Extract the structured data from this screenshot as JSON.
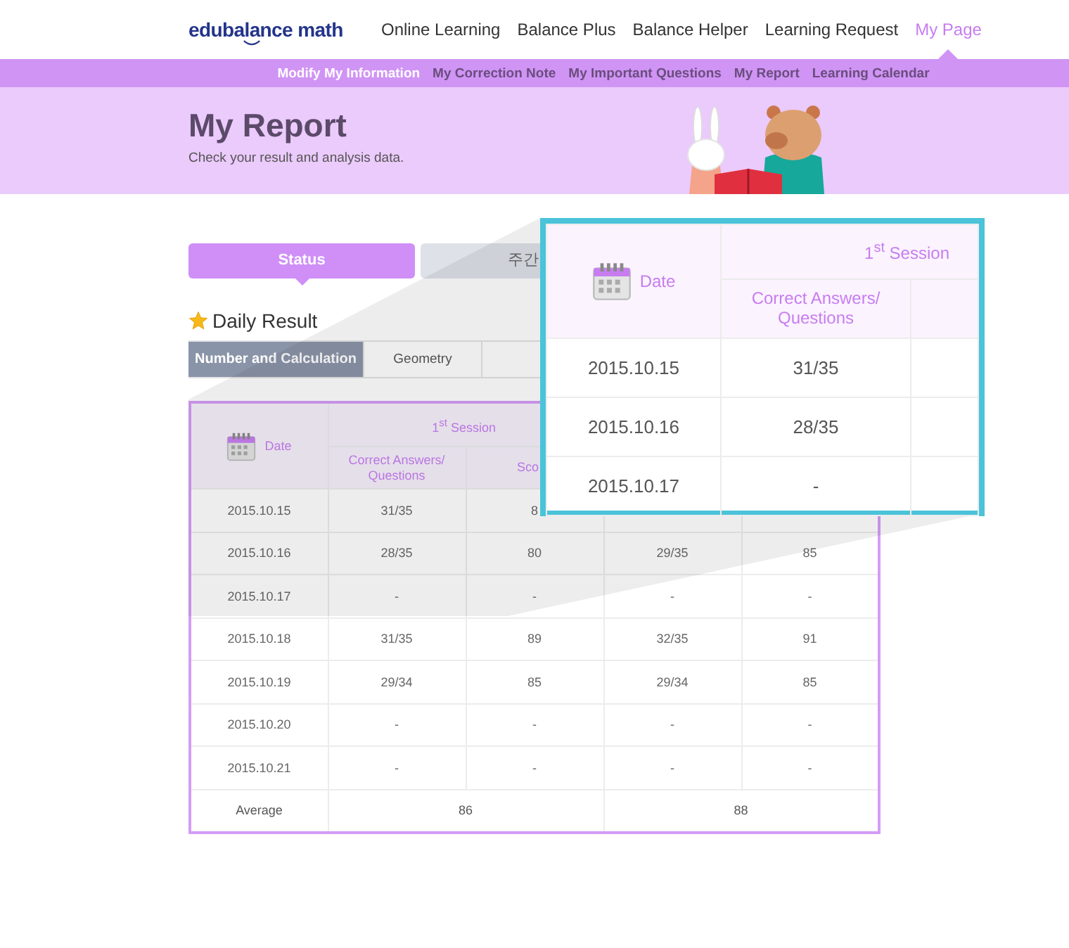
{
  "header": {
    "logo": "edubalance math",
    "nav": [
      {
        "label": "Online Learning",
        "selected": false
      },
      {
        "label": "Balance Plus",
        "selected": false
      },
      {
        "label": "Balance Helper",
        "selected": false
      },
      {
        "label": "Learning Request",
        "selected": false
      },
      {
        "label": "My Page",
        "selected": true
      }
    ]
  },
  "subnav": [
    {
      "label": "Modify My Information",
      "selected": true
    },
    {
      "label": "My Correction Note",
      "selected": false
    },
    {
      "label": "My Important Questions",
      "selected": false
    },
    {
      "label": "My Report",
      "selected": false
    },
    {
      "label": "Learning Calendar",
      "selected": false
    }
  ],
  "banner": {
    "title": "My Report",
    "subtitle": "Check your result and analysis data."
  },
  "view_tabs": [
    {
      "label": "Status",
      "selected": true
    },
    {
      "label": "주간",
      "selected": false
    }
  ],
  "section_title": "Daily Result",
  "subject_tabs": [
    {
      "label": "Number and Calculation",
      "selected": true
    },
    {
      "label": "Geometry",
      "selected": false
    }
  ],
  "table": {
    "date_header": "Date",
    "session_header": "1$^{st}$ Session",
    "subheaders": [
      "Correct Answers/ Questions",
      "Sco"
    ],
    "rows": [
      {
        "cells": [
          "2015.10.15",
          "31/35",
          "8"
        ]
      },
      {
        "cells": [
          "2015.10.16",
          "28/35",
          "80",
          "29/35",
          "85"
        ]
      },
      {
        "cells": [
          "2015.10.17",
          "-",
          "-",
          "-",
          "-"
        ]
      },
      {
        "cells": [
          "2015.10.18",
          "31/35",
          "89",
          "32/35",
          "91"
        ]
      },
      {
        "cells": [
          "2015.10.19",
          "29/34",
          "85",
          "29/34",
          "85"
        ]
      },
      {
        "cells": [
          "2015.10.20",
          "-",
          "-",
          "-",
          "-"
        ]
      },
      {
        "cells": [
          "2015.10.21",
          "-",
          "-",
          "-",
          "-"
        ]
      }
    ],
    "average": {
      "label": "Average",
      "values": [
        "86",
        "88"
      ]
    }
  },
  "magnifier": {
    "date_header": "Date",
    "session_header": "1$^{st}$ Session",
    "subheader": "Correct Answers/ Questions",
    "rows": [
      {
        "date": "2015.10.15",
        "value": "31/35"
      },
      {
        "date": "2015.10.16",
        "value": "28/35"
      },
      {
        "date": "2015.10.17",
        "value": "-"
      }
    ]
  }
}
